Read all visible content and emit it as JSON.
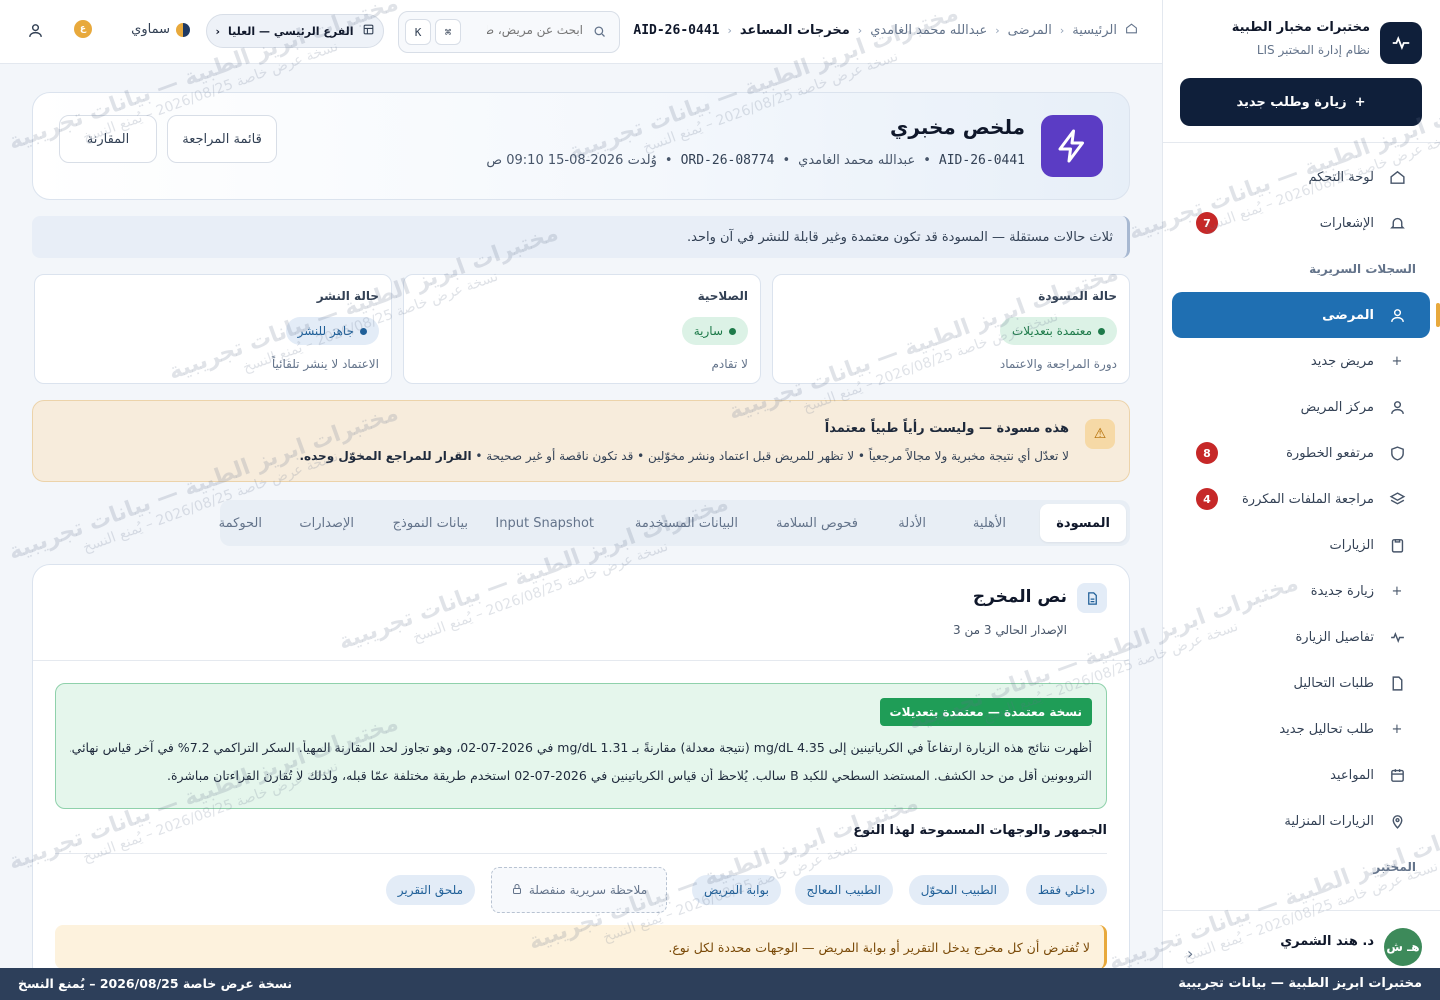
{
  "brand": {
    "name": "مختبرات مخبار الطبية",
    "subtitle": "نظام إدارة المختبر LIS"
  },
  "sidebar": {
    "new_visit_label": "زيارة وطلب جديد",
    "items": [
      {
        "label": "لوحة التحكم",
        "icon": "home-icon"
      },
      {
        "label": "الإشعارات",
        "icon": "bell-icon",
        "badge": "7"
      },
      {
        "group": "السجلات السريرية"
      },
      {
        "label": "المرضى",
        "icon": "user-icon",
        "active": true
      },
      {
        "label": "مريض جديد",
        "icon": "plus-icon"
      },
      {
        "label": "مركز المريض",
        "icon": "user-icon"
      },
      {
        "label": "مرتفعو الخطورة",
        "icon": "shield-icon",
        "badge": "8"
      },
      {
        "label": "مراجعة الملفات المكررة",
        "icon": "layers-icon",
        "badge": "4"
      },
      {
        "label": "الزيارات",
        "icon": "clipboard-icon"
      },
      {
        "label": "زيارة جديدة",
        "icon": "plus-icon"
      },
      {
        "label": "تفاصيل الزيارة",
        "icon": "pulse-icon"
      },
      {
        "label": "طلبات التحاليل",
        "icon": "file-icon"
      },
      {
        "label": "طلب تحاليل جديد",
        "icon": "plus-icon"
      },
      {
        "label": "المواعيد",
        "icon": "calendar-icon"
      },
      {
        "label": "الزيارات المنزلية",
        "icon": "map-pin-icon"
      },
      {
        "group": "المختبر"
      }
    ],
    "user": {
      "initials": "هـ ش",
      "name": "د. هند الشمري"
    }
  },
  "topbar": {
    "breadcrumb": [
      "الرئيسية",
      "المرضى",
      "عبدالله محمد الغامدي",
      "مخرجات المساعد",
      "AID-26-0441"
    ],
    "search_placeholder": "ابحث عن مريض، طلب",
    "kbd_1": "⌘",
    "kbd_2": "K",
    "branch": "الفرع الرئيسي — العليا",
    "theme": "سماوي",
    "lang_badge": "ع"
  },
  "header": {
    "title": "ملخص مخبري",
    "meta": [
      "AID-26-0441",
      "عبدالله محمد الغامدي",
      "ORD-26-08774",
      "وُلدت 2026-08-15 09:10 ص"
    ],
    "review_button": "قائمة المراجعة",
    "compare_button": "المقارنة"
  },
  "info_strip": "ثلاث حالات مستقلة — المسودة قد تكون معتمدة وغير قابلة للنشر في آن واحد.",
  "states": [
    {
      "label": "حالة المسودة",
      "value": "معتمدة بتعديلات",
      "sub": "دورة المراجعة والاعتماد",
      "color": "green"
    },
    {
      "label": "الصلاحية",
      "value": "سارية",
      "sub": "لا تقادم",
      "color": "green"
    },
    {
      "label": "حالة النشر",
      "value": "جاهز للنشر",
      "sub": "الاعتماد لا ينشر تلقائياً",
      "color": "blue"
    }
  ],
  "draft_warning": {
    "title": "هذه مسودة — وليست رأياً طبياً معتمداً",
    "body": "لا تعدّل أي نتيجة مخبرية ولا مجالاً مرجعياً • لا تظهر للمريض قبل اعتماد ونشر مخوّلين • قد تكون ناقصة أو غير صحيحة •",
    "body_bold": "القرار للمراجع المخوّل وحده."
  },
  "tabs": [
    "المسودة",
    "الأهلية",
    "الأدلة",
    "فحوص السلامة",
    "البيانات المستخدمة",
    "Input Snapshot",
    "بيانات النموذج",
    "الإصدارات",
    "الحوكمة"
  ],
  "output": {
    "title": "نص المخرج",
    "version": "الإصدار الحالي 3 من 3",
    "approved_tag": "نسخة معتمدة — معتمدة بتعديلات",
    "para_1": "أظهرت نتائج هذه الزيارة ارتفاعاً في الكرياتينين إلى 4.35 mg/dL (نتيجة معدلة) مقارنةً بـ 1.31 mg/dL في 2026-07-02، وهو تجاوز لحد المقارنة المهيأ. السكر التراكمي 7.2% في آخر قياس نهائي.",
    "para_2": "التروبونين أقل من حد الكشف. المستضد السطحي للكبد B سالب. يُلاحظ أن قياس الكرياتينين في 2026-07-02 استخدم طريقة مختلفة عمّا قبله، ولذلك لا تُقارن القراءتان مباشرة.",
    "audience_title": "الجمهور والوجهات المسموحة لهذا النوع",
    "chips": [
      "داخلي فقط",
      "الطبيب المحوّل",
      "الطبيب المعالج",
      "بوابة المريض",
      "ملحق التقرير"
    ],
    "separate_note": "ملاحظة سريرية منفصلة",
    "audience_warning": "لا تُفترض أن كل مخرج يدخل التقرير أو بوابة المريض — الوجهات محددة لكل نوع."
  },
  "footer": {
    "right": "مختبرات ابريز الطبية — بيانات تجريبية",
    "left": "نسخة عرض خاصة 2026/08/25 – يُمنع النسخ"
  },
  "watermark": {
    "line_1": "مختبرات ابريز الطبية — بيانات تجريبية",
    "line_2": "نسخة عرض خاصة 2026/08/25 – يُمنع النسخ"
  },
  "colors": {
    "navy": "#0f1f3a",
    "active_blue": "#1f6fb2",
    "badge_red": "#c62828",
    "success_green": "#1f9d57",
    "warning_amber": "#e8a93c"
  }
}
